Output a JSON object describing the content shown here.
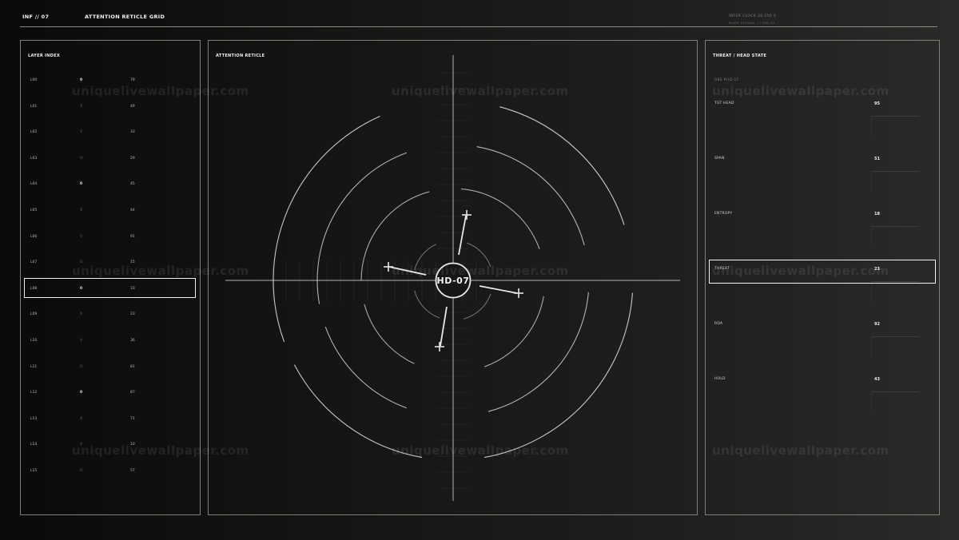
{
  "header": {
    "code": "INF // 07",
    "title": "ATTENTION RETICLE GRID",
    "meta_line1": "INFER CLOCK  28.556 S",
    "meta_line2": "MODE  RETINAL / / SPD 44"
  },
  "layers": {
    "title": "LAYER INDEX",
    "selected_index": 8,
    "rows": [
      {
        "id": "L00",
        "glyph": "0",
        "value": "79",
        "bright": true
      },
      {
        "id": "L01",
        "glyph": "X",
        "value": "49",
        "bright": false
      },
      {
        "id": "L02",
        "glyph": "V",
        "value": "33",
        "bright": false
      },
      {
        "id": "L03",
        "glyph": "O",
        "value": "29",
        "bright": false
      },
      {
        "id": "L04",
        "glyph": "0",
        "value": "45",
        "bright": true
      },
      {
        "id": "L05",
        "glyph": "X",
        "value": "44",
        "bright": false
      },
      {
        "id": "L06",
        "glyph": "V",
        "value": "91",
        "bright": false
      },
      {
        "id": "L07",
        "glyph": "O",
        "value": "15",
        "bright": false
      },
      {
        "id": "L08",
        "glyph": "0",
        "value": "33",
        "bright": true
      },
      {
        "id": "L09",
        "glyph": "X",
        "value": "23",
        "bright": false
      },
      {
        "id": "L10",
        "glyph": "V",
        "value": "36",
        "bright": false
      },
      {
        "id": "L11",
        "glyph": "O",
        "value": "81",
        "bright": false
      },
      {
        "id": "L12",
        "glyph": "0",
        "value": "87",
        "bright": true
      },
      {
        "id": "L13",
        "glyph": "X",
        "value": "71",
        "bright": false
      },
      {
        "id": "L14",
        "glyph": "V",
        "value": "10",
        "bright": false
      },
      {
        "id": "L15",
        "glyph": "O",
        "value": "57",
        "bright": false
      }
    ]
  },
  "reticle": {
    "title": "ATTENTION RETICLE",
    "center_label": "HD-07"
  },
  "threat": {
    "title": "THREAT / HEAD STATE",
    "ref": "OBS #ILD-17",
    "selected_index": 3,
    "metrics": [
      {
        "label": "TGT HEAD",
        "value": "95"
      },
      {
        "label": "SPAN",
        "value": "51"
      },
      {
        "label": "ENTROPY",
        "value": "18"
      },
      {
        "label": "THREAT",
        "value": "23"
      },
      {
        "label": "ROA",
        "value": "92"
      },
      {
        "label": "HOLD",
        "value": "43"
      }
    ]
  },
  "watermark": "uniquelivewallpaper.com",
  "colors": {
    "line": "#e8e8e6",
    "frame": "#7e7f7b",
    "background": "#0b0c0b"
  }
}
